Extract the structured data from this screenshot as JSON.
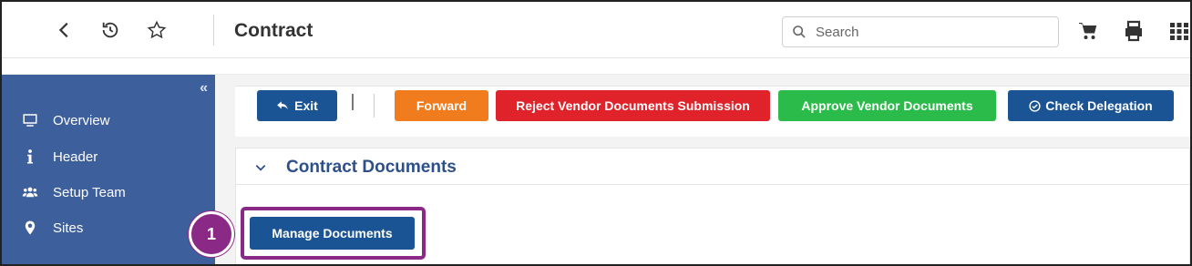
{
  "header": {
    "title": "Contract",
    "search_placeholder": "Search",
    "icons": [
      "back-icon",
      "history-icon",
      "star-icon",
      "search-icon",
      "cart-icon",
      "print-icon",
      "apps-grid-icon"
    ]
  },
  "sidebar": {
    "collapse_glyph": "«",
    "items": [
      {
        "label": "Overview",
        "icon": "monitor-icon"
      },
      {
        "label": "Header",
        "icon": "info-icon"
      },
      {
        "label": "Setup Team",
        "icon": "team-icon"
      },
      {
        "label": "Sites",
        "icon": "map-pin-icon"
      }
    ]
  },
  "toolbar": {
    "exit_label": "Exit",
    "forward_label": "Forward",
    "reject_label": "Reject Vendor Documents Submission",
    "approve_label": "Approve Vendor Documents",
    "check_label": "Check Delegation"
  },
  "section": {
    "title": "Contract Documents",
    "manage_label": "Manage Documents"
  },
  "annotation": {
    "step": "1",
    "color": "#8b2a86"
  },
  "colors": {
    "primary": "#1a5494",
    "sidebar": "#3d5f9c",
    "forward": "#f07c1e",
    "reject": "#e0232b",
    "approve": "#2bbb4a"
  }
}
